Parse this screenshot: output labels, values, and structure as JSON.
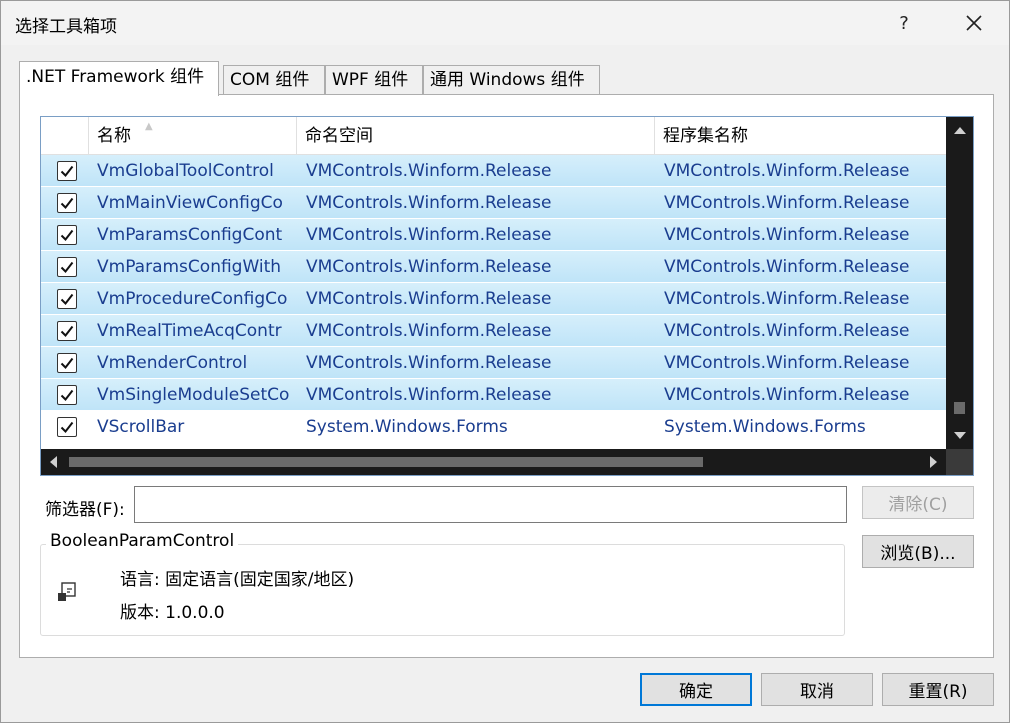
{
  "window": {
    "title": "选择工具箱项",
    "help_label": "?"
  },
  "tabs": [
    {
      "label": ".NET Framework 组件"
    },
    {
      "label": "COM 组件"
    },
    {
      "label": "WPF 组件"
    },
    {
      "label": "通用 Windows 组件"
    }
  ],
  "grid": {
    "columns": [
      "名称",
      "命名空间",
      "程序集名称"
    ],
    "rows": [
      {
        "checked": true,
        "selected": true,
        "name": "VmGlobalToolControl",
        "namespace": "VMControls.Winform.Release",
        "assembly": "VMControls.Winform.Release"
      },
      {
        "checked": true,
        "selected": true,
        "name": "VmMainViewConfigCo",
        "namespace": "VMControls.Winform.Release",
        "assembly": "VMControls.Winform.Release"
      },
      {
        "checked": true,
        "selected": true,
        "name": "VmParamsConfigCont",
        "namespace": "VMControls.Winform.Release",
        "assembly": "VMControls.Winform.Release"
      },
      {
        "checked": true,
        "selected": true,
        "name": "VmParamsConfigWith",
        "namespace": "VMControls.Winform.Release",
        "assembly": "VMControls.Winform.Release"
      },
      {
        "checked": true,
        "selected": true,
        "name": "VmProcedureConfigCo",
        "namespace": "VMControls.Winform.Release",
        "assembly": "VMControls.Winform.Release"
      },
      {
        "checked": true,
        "selected": true,
        "name": "VmRealTimeAcqContr",
        "namespace": "VMControls.Winform.Release",
        "assembly": "VMControls.Winform.Release"
      },
      {
        "checked": true,
        "selected": true,
        "name": "VmRenderControl",
        "namespace": "VMControls.Winform.Release",
        "assembly": "VMControls.Winform.Release"
      },
      {
        "checked": true,
        "selected": true,
        "name": "VmSingleModuleSetCo",
        "namespace": "VMControls.Winform.Release",
        "assembly": "VMControls.Winform.Release"
      },
      {
        "checked": true,
        "selected": false,
        "name": "VScrollBar",
        "namespace": "System.Windows.Forms",
        "assembly": "System.Windows.Forms"
      }
    ]
  },
  "filter": {
    "label": "筛选器(F):",
    "value": ""
  },
  "buttons": {
    "clear": "清除(C)",
    "browse": "浏览(B)...",
    "ok": "确定",
    "cancel": "取消",
    "reset": "重置(R)"
  },
  "details": {
    "title": "BooleanParamControl",
    "language": "语言:  固定语言(固定国家/地区)",
    "version": "版本:  1.0.0.0"
  }
}
